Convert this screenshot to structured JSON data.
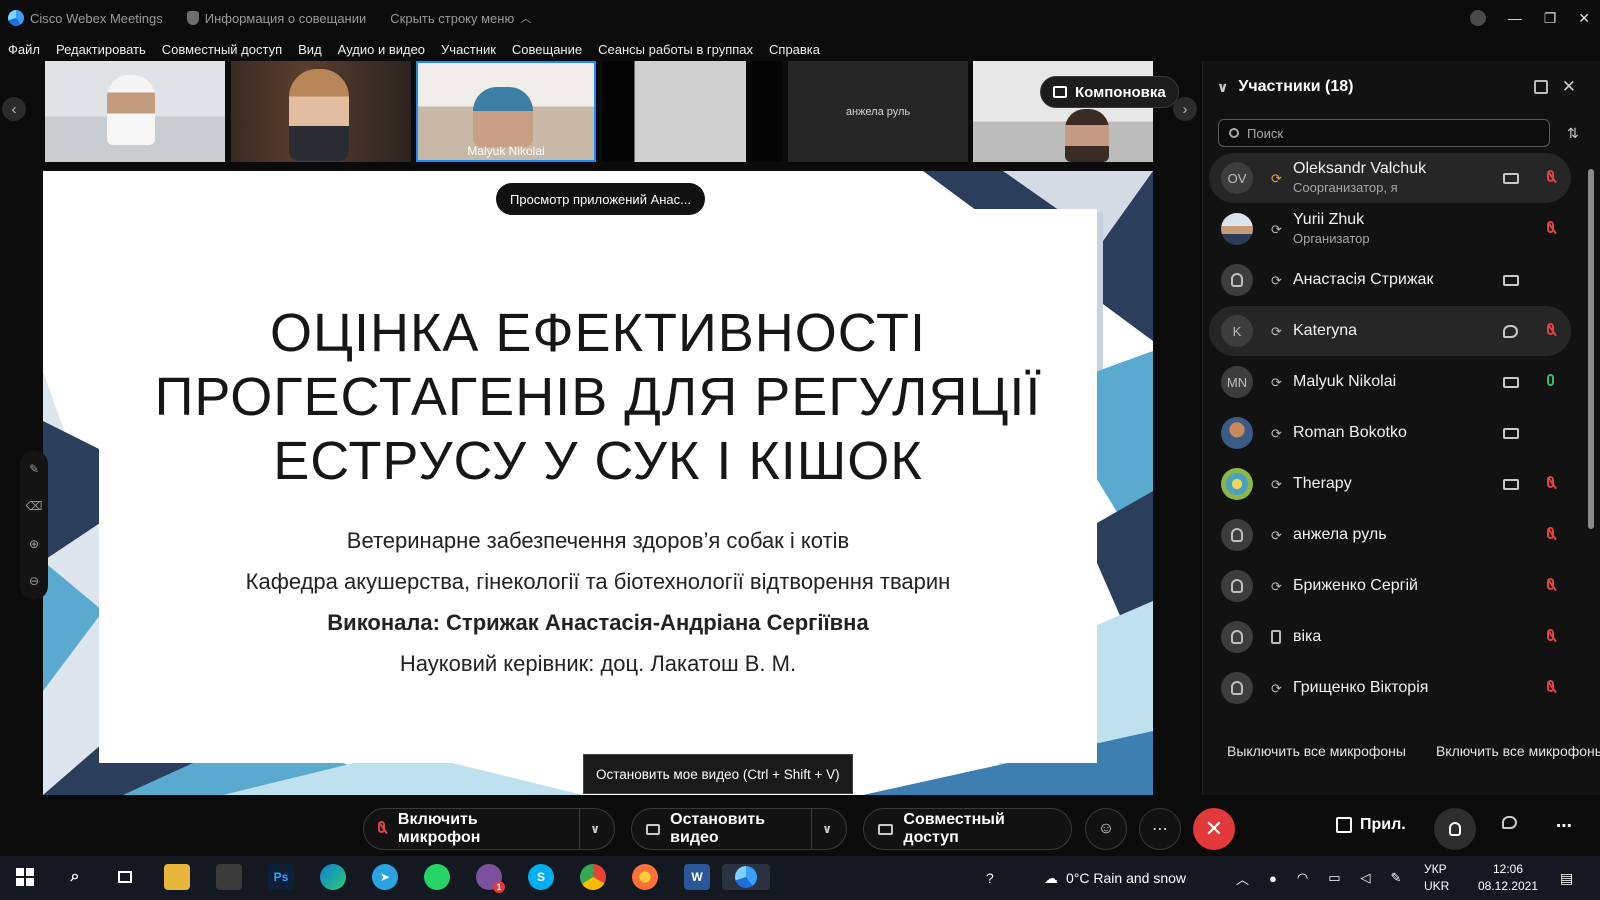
{
  "titlebar": {
    "app_name": "Cisco Webex Meetings",
    "meeting_info": "Информация о совещании",
    "hide_menu": "Скрыть строку меню"
  },
  "menu": [
    "Файл",
    "Редактировать",
    "Совместный доступ",
    "Вид",
    "Аудио и видео",
    "Участник",
    "Совещание",
    "Сеансы работы в группах",
    "Справка"
  ],
  "filmstrip": {
    "thumbs": [
      {
        "label": ""
      },
      {
        "label": ""
      },
      {
        "label": "Malyuk Nikolai",
        "active": true
      },
      {
        "label": ""
      },
      {
        "label": "анжела руль"
      },
      {
        "label": ""
      }
    ],
    "layout_button": "Компоновка"
  },
  "share": {
    "viewing_pill": "Просмотр приложений Анас..."
  },
  "slide": {
    "title_lines": [
      "ОЦІНКА ЕФЕКТИВНОСТІ",
      "ПРОГЕСТАГЕНІВ ДЛЯ РЕГУЛЯЦІЇ",
      "ЕСТРУСУ У СУК І КІШОК"
    ],
    "line1": "Ветеринарне забезпечення здоров’я собак і котів",
    "line2": "Кафедра  акушерства, гінекології та біотехнології відтворення тварин",
    "line3": "Виконала: Стрижак Анастасія-Андріана Сергіївна",
    "line4": "Науковий керівник: доц. Лакатош В. М."
  },
  "tooltip": "Остановить мое видео (Ctrl + Shift + V)",
  "panel": {
    "title": "Участники (18)",
    "search_placeholder": "Поиск",
    "participants": [
      {
        "initials": "OV",
        "name": "Oleksandr Valchuk",
        "role": "Соорганизатор, я",
        "video": true,
        "mic": "muted",
        "highlight": true
      },
      {
        "initials": "",
        "name": "Yurii Zhuk",
        "role": "Организатор",
        "video": false,
        "mic": "muted"
      },
      {
        "initials": "",
        "name": "Анастасія Стрижак",
        "role": "",
        "video": true,
        "mic": "none"
      },
      {
        "initials": "K",
        "name": "Kateryna",
        "role": "",
        "chat": true,
        "mic": "muted",
        "highlight": true
      },
      {
        "initials": "MN",
        "name": "Malyuk Nikolai",
        "role": "",
        "video": true,
        "mic": "on"
      },
      {
        "initials": "",
        "name": "Roman Bokotko",
        "role": "",
        "video": true,
        "mic": "none"
      },
      {
        "initials": "",
        "name": "Therapy",
        "role": "",
        "video": true,
        "mic": "muted"
      },
      {
        "initials": "",
        "name": "анжела руль",
        "role": "",
        "video": false,
        "mic": "muted"
      },
      {
        "initials": "",
        "name": "Бриженко Сергій",
        "role": "",
        "video": false,
        "mic": "muted"
      },
      {
        "initials": "",
        "name": "віка",
        "role": "",
        "video": false,
        "mic": "muted"
      },
      {
        "initials": "",
        "name": "Грищенко Вікторія",
        "role": "",
        "video": false,
        "mic": "muted"
      }
    ],
    "mute_all": "Выключить все микрофоны",
    "unmute_all": "Включить все микрофоны"
  },
  "controls": {
    "mic": "Включить микрофон",
    "video": "Остановить видео",
    "share": "Совместный доступ",
    "apps": "Прил."
  },
  "taskbar": {
    "weather": "0°C  Rain and snow",
    "lang_top": "УКР",
    "lang_bottom": "UKR",
    "time": "12:06",
    "date": "08.12.2021",
    "badge": "1"
  }
}
